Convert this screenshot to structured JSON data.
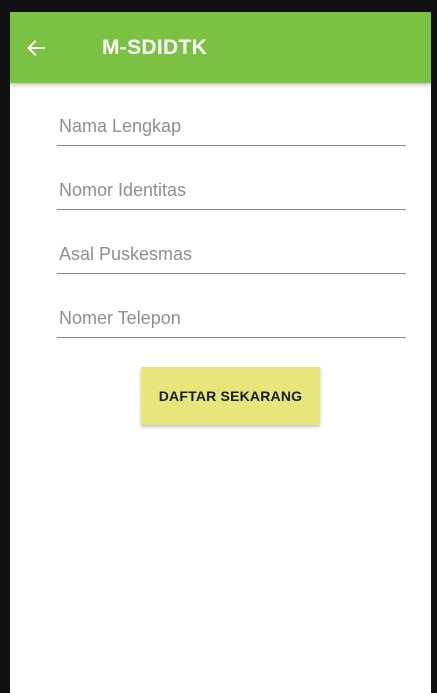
{
  "appbar": {
    "title": "M-SDIDTK",
    "back_icon": "arrow-left-icon",
    "color": "#7cc242"
  },
  "form": {
    "fields": [
      {
        "placeholder": "Nama Lengkap",
        "value": ""
      },
      {
        "placeholder": "Nomor Identitas",
        "value": ""
      },
      {
        "placeholder": "Asal Puskesmas",
        "value": ""
      },
      {
        "placeholder": "Nomer Telepon",
        "value": ""
      }
    ],
    "submit_label": "DAFTAR SEKARANG",
    "submit_color": "#e6e67a"
  }
}
